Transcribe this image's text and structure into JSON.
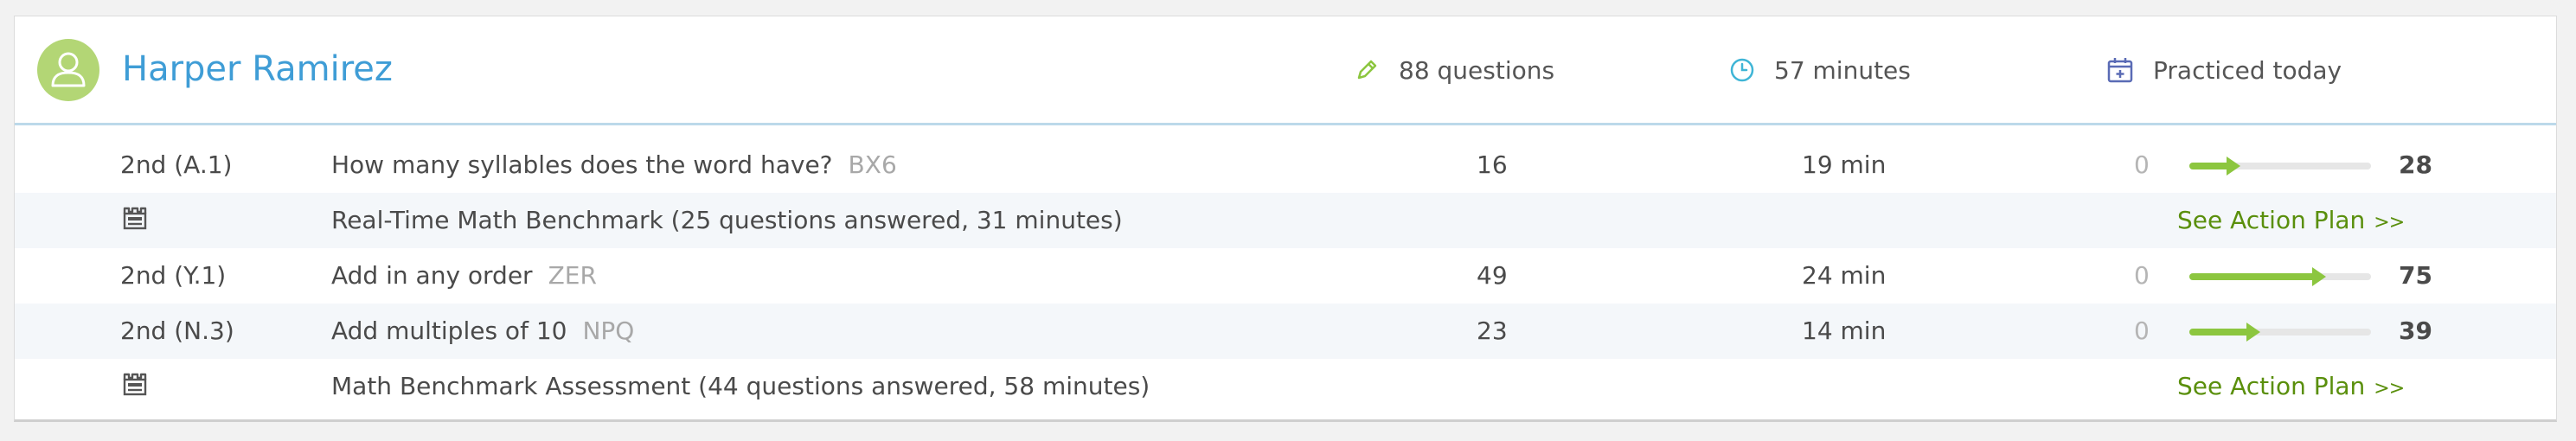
{
  "student": {
    "name": "Harper Ramirez"
  },
  "stats": {
    "questions": "88 questions",
    "time": "57 minutes",
    "practiced": "Practiced today"
  },
  "colors": {
    "accent_blue": "#3f9dd6",
    "avatar_green": "#b3d675",
    "bar_green": "#8cc63f",
    "action_green": "#5a8f0c"
  },
  "skills": [
    {
      "grade": "2nd (A.1)",
      "name": "How many syllables does the word have?",
      "code": "BX6",
      "questions": "16",
      "time": "19 min",
      "start_score": "0",
      "end_score": "28",
      "progress_percent": 28
    },
    {
      "grade": "2nd (Y.1)",
      "name": "Add in any order",
      "code": "ZER",
      "questions": "49",
      "time": "24 min",
      "start_score": "0",
      "end_score": "75",
      "progress_percent": 75
    },
    {
      "grade": "2nd (N.3)",
      "name": "Add multiples of 10",
      "code": "NPQ",
      "questions": "23",
      "time": "14 min",
      "start_score": "0",
      "end_score": "39",
      "progress_percent": 39
    }
  ],
  "benchmarks": [
    {
      "icon": "benchmark-icon",
      "text": "Real-Time Math Benchmark (25 questions answered, 31 minutes)",
      "action": "See Action Plan",
      "action_chevrons": ">>"
    },
    {
      "icon": "benchmark-icon",
      "text": "Math Benchmark Assessment (44 questions answered, 58 minutes)",
      "action": "See Action Plan",
      "action_chevrons": ">>"
    }
  ]
}
